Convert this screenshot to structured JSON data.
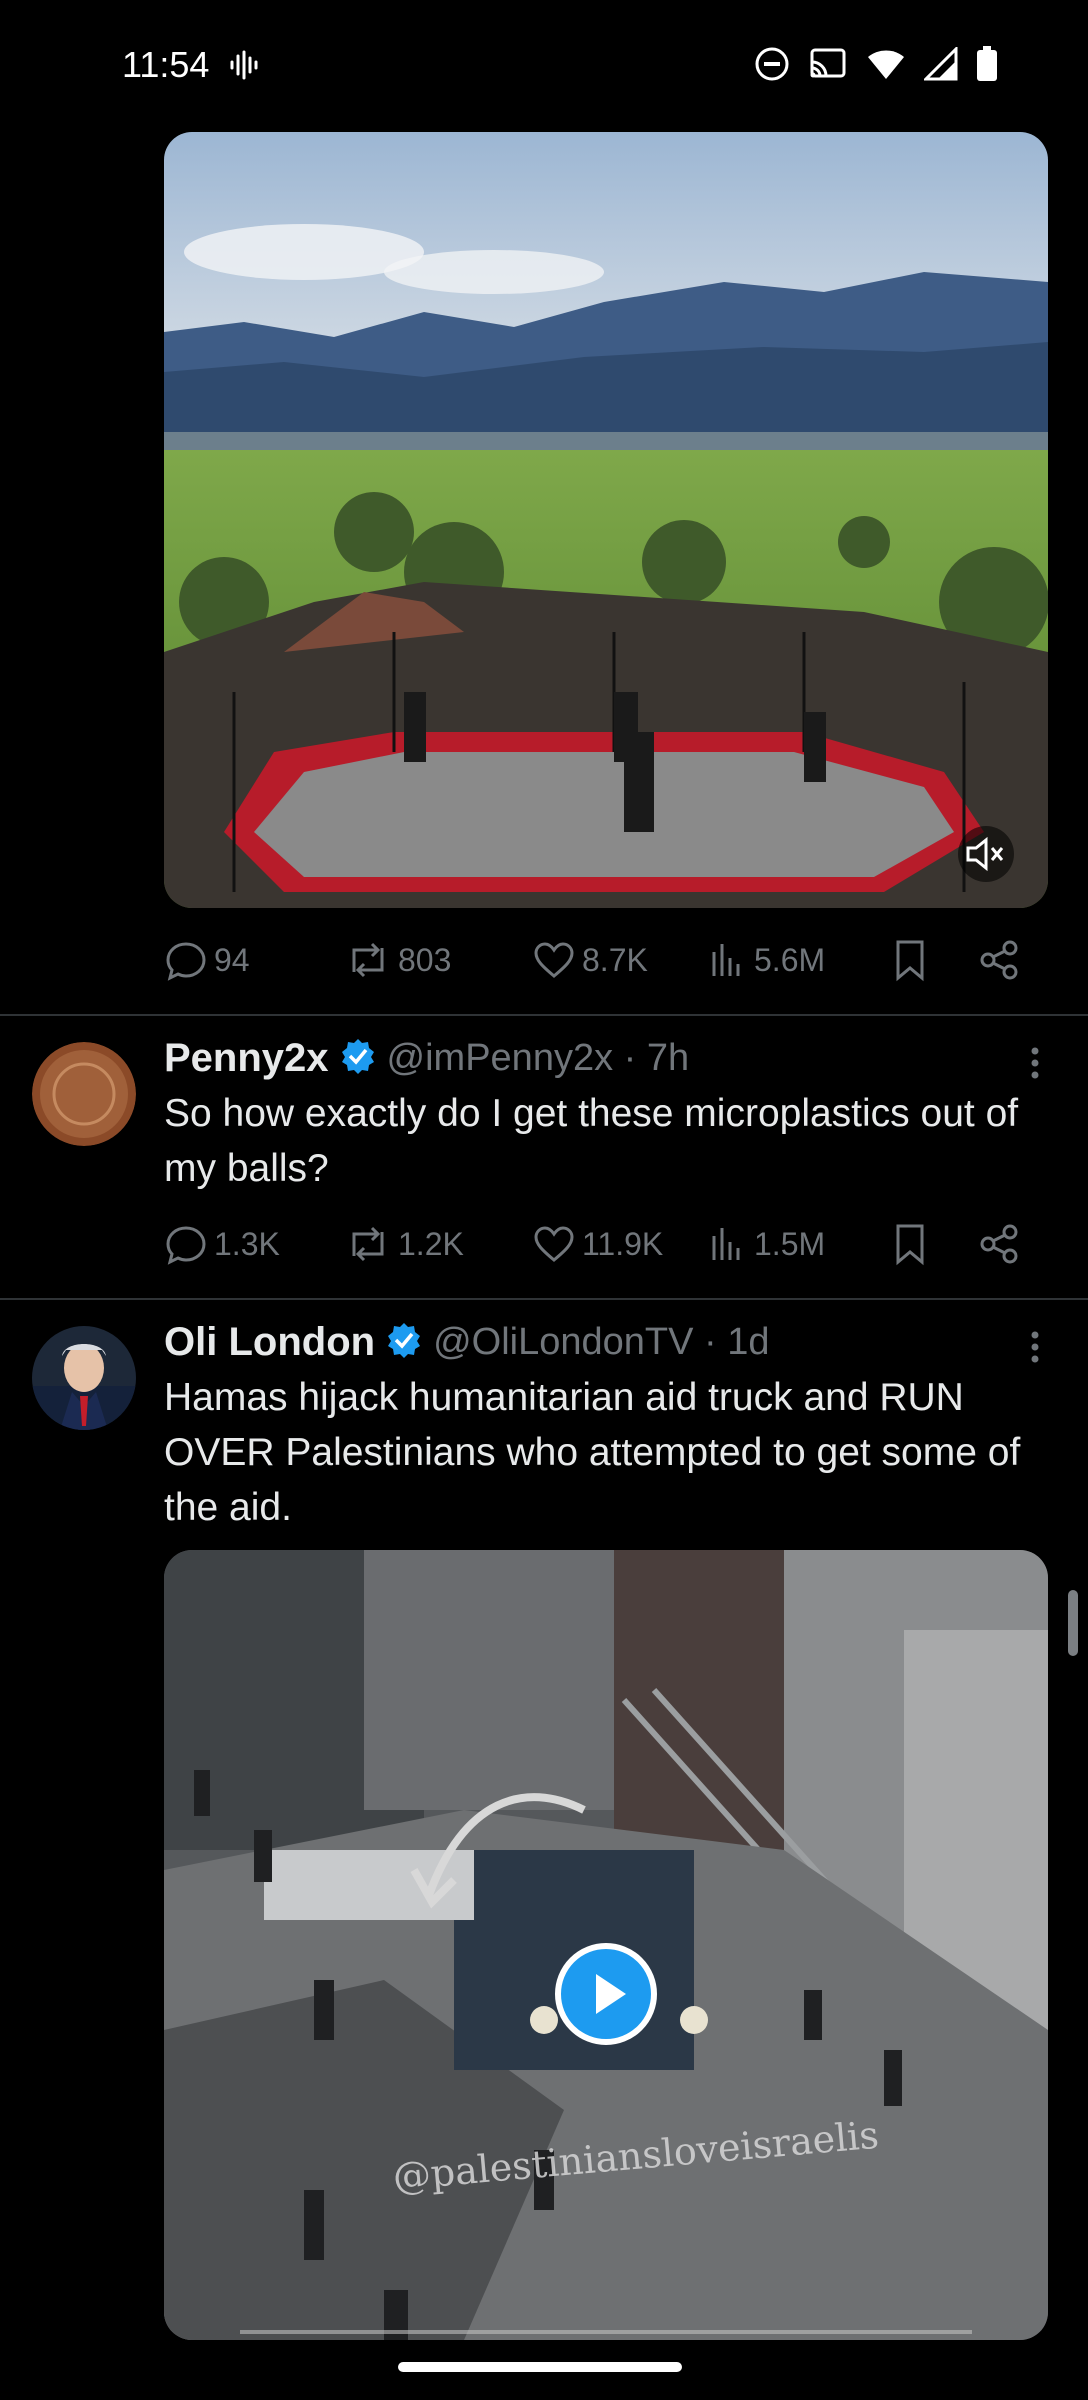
{
  "status_bar": {
    "time": "11:54",
    "icons": [
      "voicemail-icon",
      "dnd-icon",
      "cast-icon",
      "wifi-icon",
      "signal-icon",
      "battery-icon"
    ]
  },
  "tweets": [
    {
      "media": {
        "type": "video",
        "muted": true,
        "icon": "mute-icon"
      },
      "actions": {
        "replies": "94",
        "retweets": "803",
        "likes": "8.7K",
        "views": "5.6M"
      }
    },
    {
      "name": "Penny2x",
      "handle": "@imPenny2x · 7h",
      "verified": true,
      "text": "So how exactly do I get these microplastics out of my balls?",
      "actions": {
        "replies": "1.3K",
        "retweets": "1.2K",
        "likes": "11.9K",
        "views": "1.5M"
      }
    },
    {
      "name": "Oli London",
      "handle": "@OliLondonTV · 1d",
      "verified": true,
      "text": "Hamas hijack humanitarian aid truck and RUN OVER Palestinians who attempted to get some of the aid.",
      "media": {
        "type": "video",
        "watermark": "@palestiniansloveisraelis",
        "icon": "play-icon"
      }
    }
  ],
  "colors": {
    "background": "#000000",
    "text": "#e7e9ea",
    "muted": "#71767b",
    "verified": "#1d9bf0",
    "divider": "#2f3336"
  }
}
